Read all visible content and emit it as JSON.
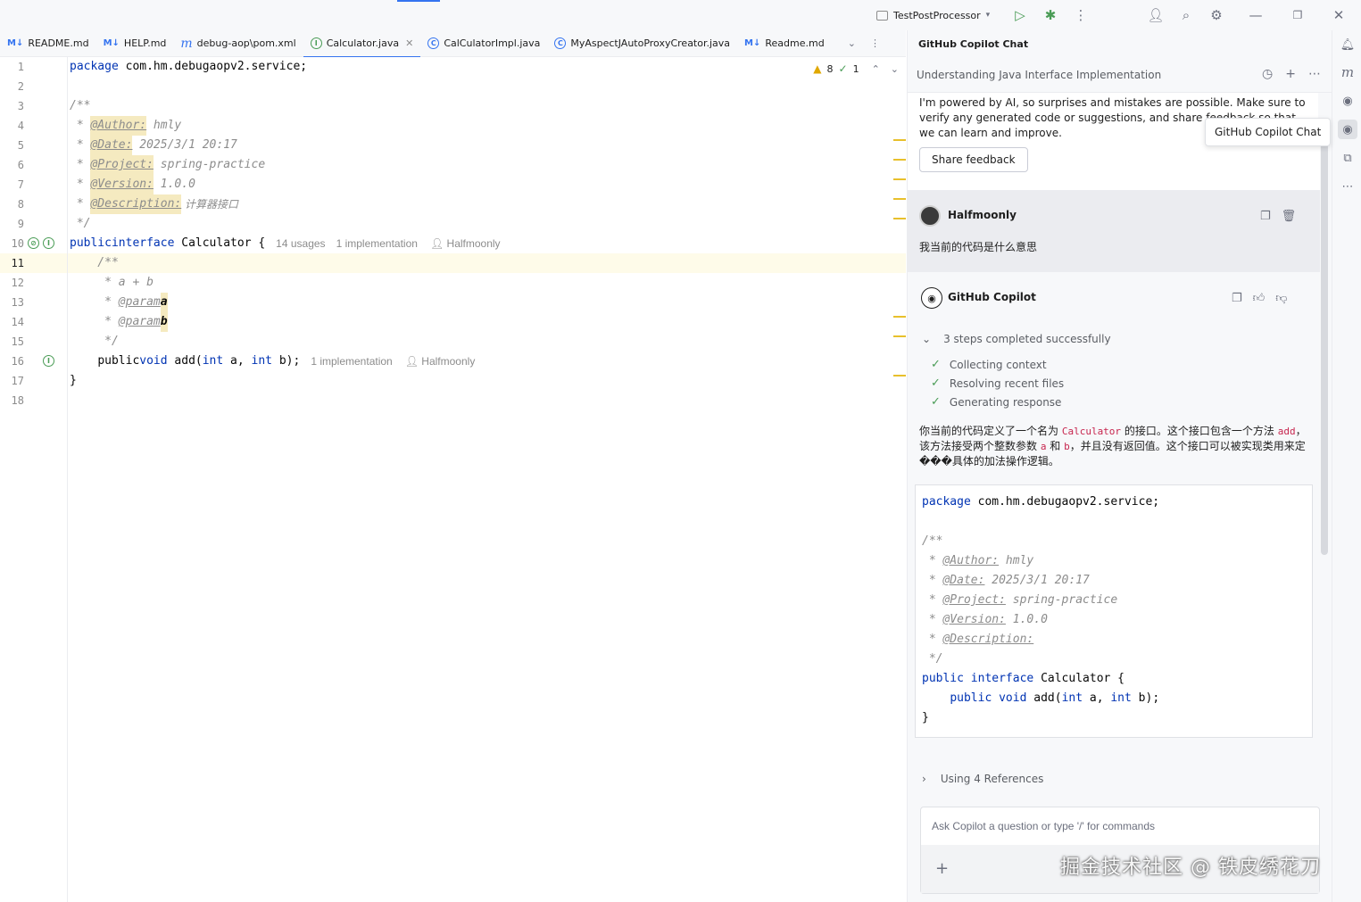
{
  "titlebar": {
    "run_config": "TestPostProcessor",
    "icons": [
      "run-icon",
      "debug-icon",
      "more-icon",
      "add-user-icon",
      "search-icon",
      "settings-icon",
      "minimize-icon",
      "maximize-icon",
      "close-icon"
    ]
  },
  "editor_tabs": [
    {
      "icon": "M↓",
      "label": "README.md"
    },
    {
      "icon": "M↓",
      "label": "HELP.md"
    },
    {
      "icon": "m",
      "label": "debug-aop\\pom.xml"
    },
    {
      "icon": "I",
      "label": "Calculator.java",
      "active": true
    },
    {
      "icon": "C",
      "label": "CalCulatorImpl.java"
    },
    {
      "icon": "C",
      "label": "MyAspectJAutoProxyCreator.java"
    },
    {
      "icon": "M↓",
      "label": "Readme.md"
    }
  ],
  "inspections": {
    "warnings": "8",
    "ok": "1"
  },
  "editor": {
    "line_numbers": [
      "1",
      "2",
      "3",
      "4",
      "5",
      "6",
      "7",
      "8",
      "9",
      "10",
      "11",
      "12",
      "13",
      "14",
      "15",
      "16",
      "17",
      "18"
    ],
    "l1_kw": "package",
    "l1_rest": " com.hm.debugaopv2.service;",
    "l3": "/**",
    "star": " * ",
    "author_tag": "@Author:",
    "author_val": " hmly",
    "date_tag": "@Date:",
    "date_val": " 2025/3/1 20:17",
    "project_tag": "@Project:",
    "project_val": " spring-practice",
    "version_tag": "@Version:",
    "version_val": " 1.0.0",
    "desc_tag": "@Description:",
    "desc_val": " 计算器接口",
    "l9": " */",
    "l10_kw1": "public",
    "l10_kw2": "interface",
    "l10_name": " Calculator {",
    "l10_hint1": "14 usages",
    "l10_hint2": "1 implementation",
    "l10_hint3": "Halfmoonly",
    "l11": "    /**",
    "l12": "     * a + b",
    "l13_pre": "     * ",
    "param_tag": "@param",
    "param_a": "a",
    "param_b": "b",
    "l15": "     */",
    "l16_kw1": "public",
    "l16_kw2": "void",
    "l16_name": " add(",
    "l16_int": "int",
    "l16_a": " a, ",
    "l16_b": " b);",
    "l16_hint1": "1 implementation",
    "l16_hint2": "Halfmoonly",
    "l17": "}"
  },
  "copilot": {
    "title": "GitHub Copilot Chat",
    "conversation_title": "Understanding Java Interface Implementation",
    "disclaimer": "I'm powered by AI, so surprises and mistakes are possible. Make sure to verify any generated code or suggestions, and share feedback so that we can learn and improve.",
    "tooltip": "GitHub Copilot Chat",
    "share_feedback": "Share feedback",
    "user_name": "Halfmoonly",
    "user_message": "我当前的代码是什么意思",
    "bot_name": "GitHub Copilot",
    "steps_summary": "3 steps completed successfully",
    "steps": [
      "Collecting context",
      "Resolving recent files",
      "Generating response"
    ],
    "answer_p1": "你当前的代码定义了一个名为 ",
    "answer_code1": "Calculator",
    "answer_p2": " 的接口。这个接口包含一个方法 ",
    "answer_code2": "add",
    "answer_p3": "，该方法接受两个整数参数 ",
    "answer_code3": "a",
    "answer_p4": " 和 ",
    "answer_code4": "b",
    "answer_p5": "，并且没有返回值。这个接口可以被实现类用来定���具体的加法操作逻辑。",
    "code": {
      "l1_kw": "package",
      "l1_rest": " com.hm.debugaopv2.service;",
      "l3": "/**",
      "author": "@Author:",
      "author_val": " hmly",
      "date": "@Date:",
      "date_val": " 2025/3/1 20:17",
      "project": "@Project:",
      "project_val": " spring-practice",
      "version": "@Version:",
      "version_val": " 1.0.0",
      "desc": "@Description:",
      "l9": " */",
      "l10_kw1": "public",
      "l10_kw2": "interface",
      "l10_rest": " Calculator {",
      "l11_pre": "    ",
      "l11_kw1": "public",
      "l11_kw2": "void",
      "l11_name": " add(",
      "l11_int": "int",
      "l11_a": " a, ",
      "l11_b": " b);",
      "l12": "}"
    },
    "references": "Using 4 References",
    "input_placeholder": "Ask Copilot a question or type '/' for commands"
  },
  "watermark": "掘金技术社区 @ 铁皮绣花刀"
}
